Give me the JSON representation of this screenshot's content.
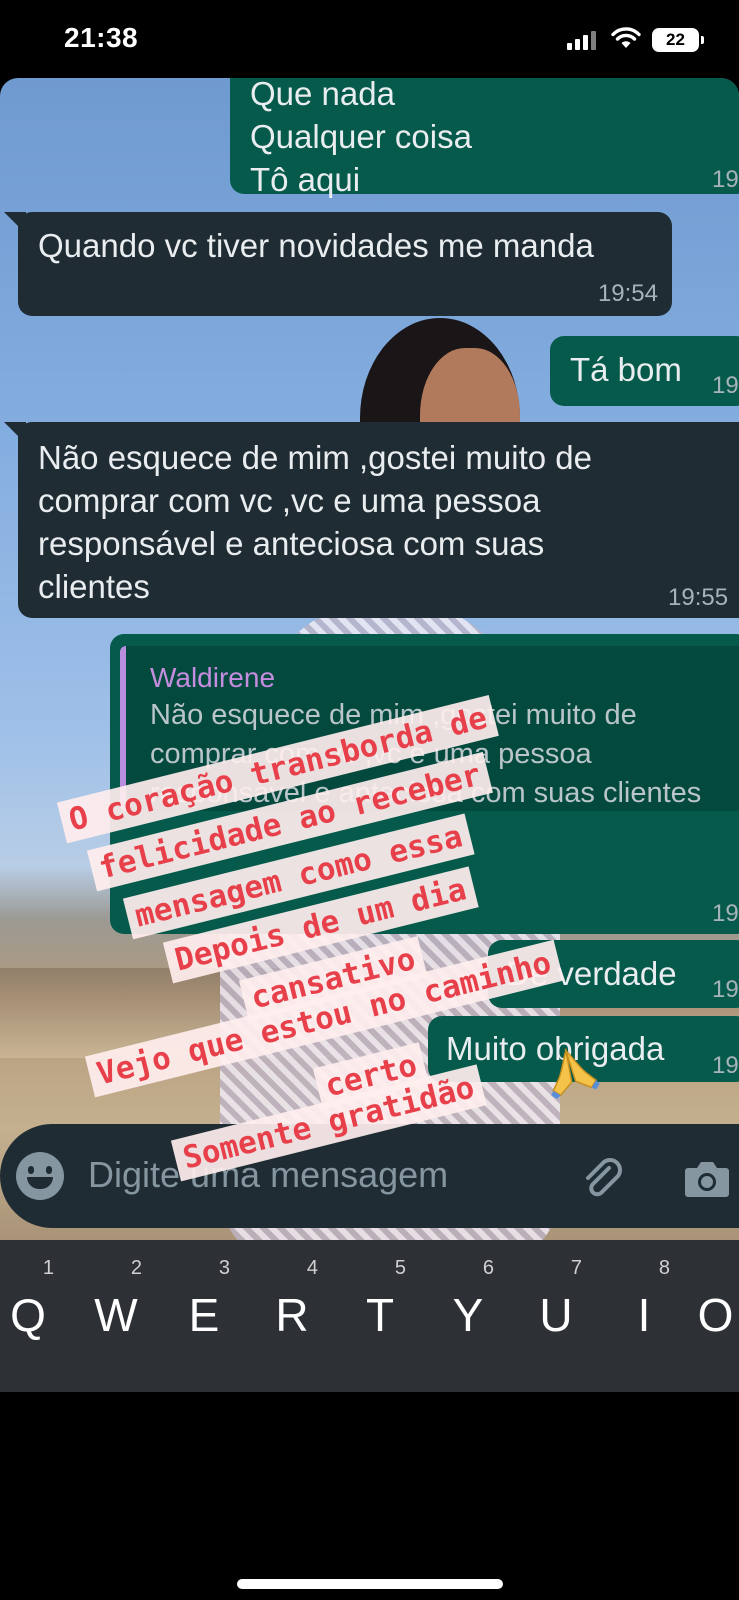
{
  "status_bar": {
    "time": "21:38",
    "battery": "22"
  },
  "chat": {
    "messages": [
      {
        "direction": "out",
        "lines": [
          "Que nada",
          "Qualquer coisa",
          "Tô aqui"
        ],
        "time": "19"
      },
      {
        "direction": "in",
        "text": "Quando vc tiver novidades me manda",
        "time": "19:54"
      },
      {
        "direction": "out",
        "text": "Tá bom",
        "time": "19"
      },
      {
        "direction": "in",
        "lines": [
          "Não esquece de mim ,gostei muito de",
          "comprar com vc ,vc e uma pessoa",
          "responsável e anteciosa com suas",
          "clientes"
        ],
        "time": "19:55"
      },
      {
        "direction": "out",
        "reply_to": {
          "name": "Waldirene",
          "lines": [
            "Não esquece de mim ,gostei muito de",
            "comprar com vc ,vc e uma pessoa",
            "responsável e anteciosa com suas clientes"
          ]
        },
        "time": "19"
      },
      {
        "direction": "out",
        "text": "De verdade",
        "time": "19"
      },
      {
        "direction": "out",
        "text": "Muito obrigada",
        "time": "19"
      }
    ]
  },
  "composer": {
    "placeholder": "Digite uma mensagem",
    "icons": [
      "emoji-icon",
      "paperclip-icon",
      "camera-icon"
    ]
  },
  "keyboard": {
    "keys": [
      {
        "letter": "Q",
        "hint": "1"
      },
      {
        "letter": "W",
        "hint": "2"
      },
      {
        "letter": "E",
        "hint": "3"
      },
      {
        "letter": "R",
        "hint": "4"
      },
      {
        "letter": "T",
        "hint": "5"
      },
      {
        "letter": "Y",
        "hint": "6"
      },
      {
        "letter": "U",
        "hint": "7"
      },
      {
        "letter": "I",
        "hint": "8"
      },
      {
        "letter": "O",
        "hint": ""
      }
    ]
  },
  "captions": [
    "O coração transborda de",
    "felicidade ao receber",
    "mensagem como essa",
    "Depois de um dia",
    "cansativo",
    "Vejo que estou no caminho",
    "certo",
    "Somente gratidão"
  ],
  "caption_emoji": "praying-hands-icon",
  "colors": {
    "incoming_bubble": "#1f2c33",
    "outgoing_bubble": "#055a4b",
    "caption_text": "#e8404a",
    "caption_bg": "#ffeeee",
    "quote_name": "#c48ddf"
  }
}
